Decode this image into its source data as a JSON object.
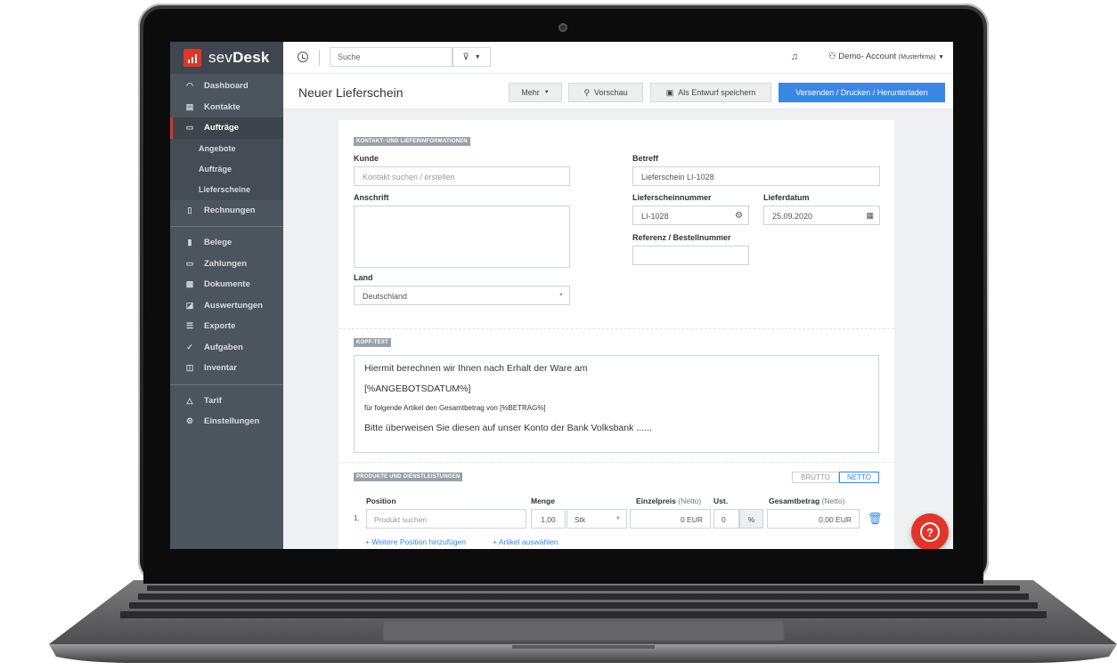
{
  "brand": {
    "name_light": "sev",
    "name_bold": "Desk"
  },
  "sidebar": {
    "items": [
      {
        "label": "Dashboard",
        "icon": "dashboard-icon"
      },
      {
        "label": "Kontakte",
        "icon": "contacts-icon"
      },
      {
        "label": "Aufträge",
        "icon": "folder-icon",
        "active": true
      },
      {
        "label": "Angebote",
        "sub": true
      },
      {
        "label": "Aufträge",
        "sub": true
      },
      {
        "label": "Lieferscheine",
        "sub": true
      },
      {
        "label": "Rechnungen",
        "icon": "document-icon"
      },
      {
        "label": "Belege",
        "icon": "receipt-icon"
      },
      {
        "label": "Zahlungen",
        "icon": "card-icon"
      },
      {
        "label": "Dokumente",
        "icon": "calendar-icon"
      },
      {
        "label": "Auswertungen",
        "icon": "report-icon"
      },
      {
        "label": "Exporte",
        "icon": "export-icon"
      },
      {
        "label": "Aufgaben",
        "icon": "check-icon"
      },
      {
        "label": "Inventar",
        "icon": "box-icon"
      },
      {
        "label": "Tarif",
        "icon": "bell-icon"
      },
      {
        "label": "Einstellungen",
        "icon": "gear-icon"
      }
    ]
  },
  "topbar": {
    "search_placeholder": "Suche",
    "account_name": "Demo- Account",
    "account_company": "(Musterfirma)"
  },
  "actionbar": {
    "title": "Neuer Lieferschein",
    "more_label": "Mehr",
    "preview_label": "Vorschau",
    "draft_label": "Als Entwurf speichern",
    "send_label": "Versenden / Drucken / Herunterladen"
  },
  "form": {
    "contact_section": "KONTAKT- UND LIEFERINFORMATIONEN",
    "customer_label": "Kunde",
    "customer_placeholder": "Kontakt suchen / erstellen",
    "address_label": "Anschrift",
    "country_label": "Land",
    "country_value": "Deutschland",
    "subject_label": "Betreff",
    "subject_value": "Lieferschein LI-1028",
    "number_label": "Lieferscheinnummer",
    "number_value": "LI-1028",
    "date_label": "Lieferdatum",
    "date_value": "25.09.2020",
    "reference_label": "Referenz / Bestellnummer",
    "header_section": "KOPF-TEXT",
    "header_lines": [
      "Hiermit berechnen wir Ihnen nach Erhalt der Ware am",
      "[%ANGEBOTSDATUM%]",
      "für folgende Artikel den Gesamtbetrag von  [%BETRAG%]",
      "Bitte überweisen Sie diesen auf unser Konto der Bank Volksbank ......"
    ],
    "products_section": "PRODUKTE UND DIENSTLEISTUNGEN",
    "brutto_label": "BRUTTO",
    "netto_label": "NETTO",
    "col_position": "Position",
    "col_quantity": "Menge",
    "col_unit_price": "Einzelpreis",
    "col_unit_price_suffix": "(Netto)",
    "col_tax": "Ust.",
    "col_total": "Gesamtbetrag",
    "col_total_suffix": "(Netto)",
    "row_number": "1.",
    "product_placeholder": "Produkt suchen",
    "quantity_value": "1,00",
    "unit_value": "Stk",
    "unit_price_value": "0 EUR",
    "tax_value": "0",
    "tax_unit": "%",
    "total_value": "0,00 EUR",
    "add_position_link": "+ Weitere Position hinzufügen",
    "select_article_link": "+ Artikel auswählen"
  },
  "help_icon_label": "?"
}
